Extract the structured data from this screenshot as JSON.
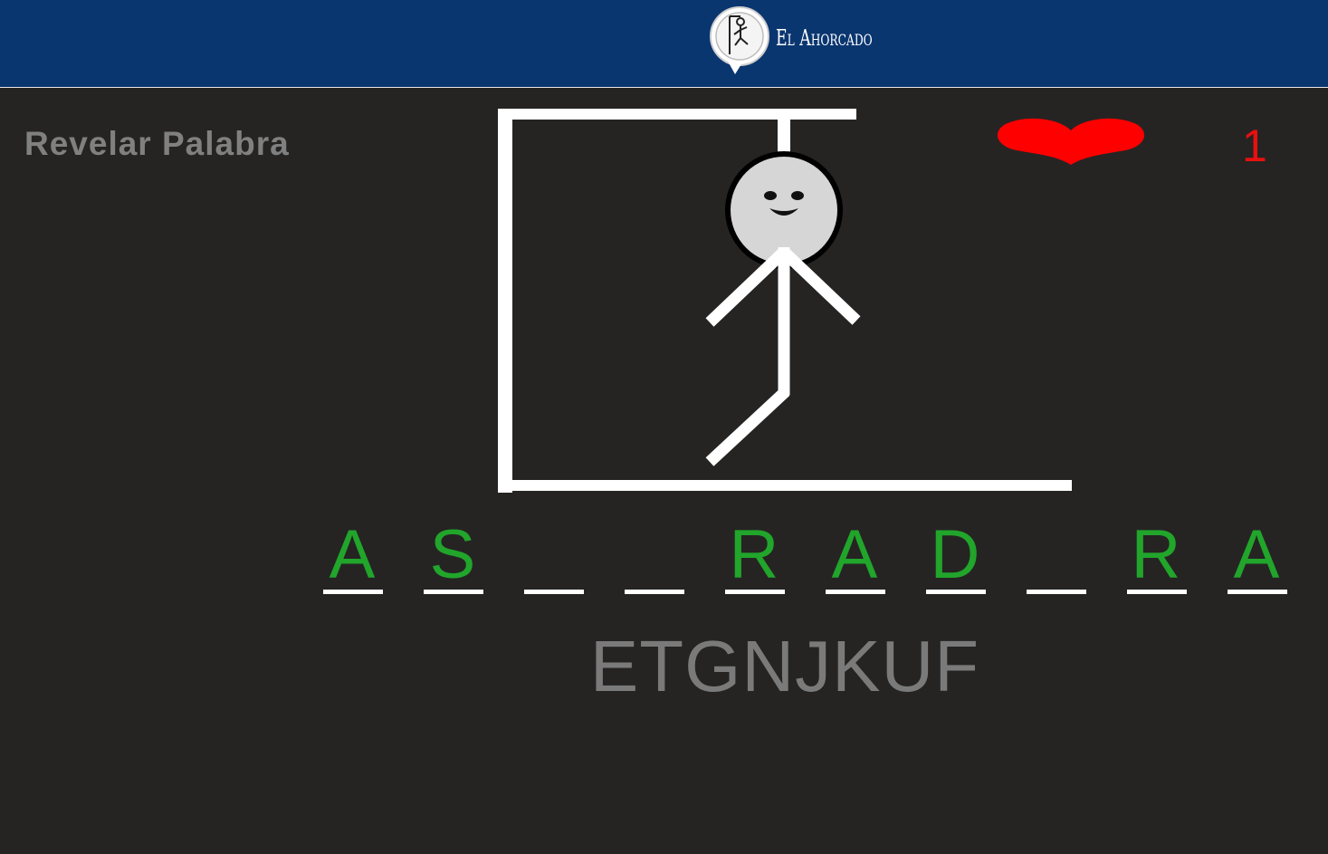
{
  "header": {
    "app_title": "El Ahorcado",
    "logo_icon": "hangman-logo-icon",
    "background": "#0a3670"
  },
  "controls": {
    "reveal_label": "Revelar Palabra"
  },
  "lives": {
    "icon": "heart-icon",
    "count": "1",
    "color": "#e81010"
  },
  "word": {
    "slots": [
      "A",
      "S",
      "",
      "",
      "R",
      "A",
      "D",
      "",
      "R",
      "A"
    ],
    "letter_color": "#21a52b"
  },
  "used_letters": "ETGNJKUF"
}
